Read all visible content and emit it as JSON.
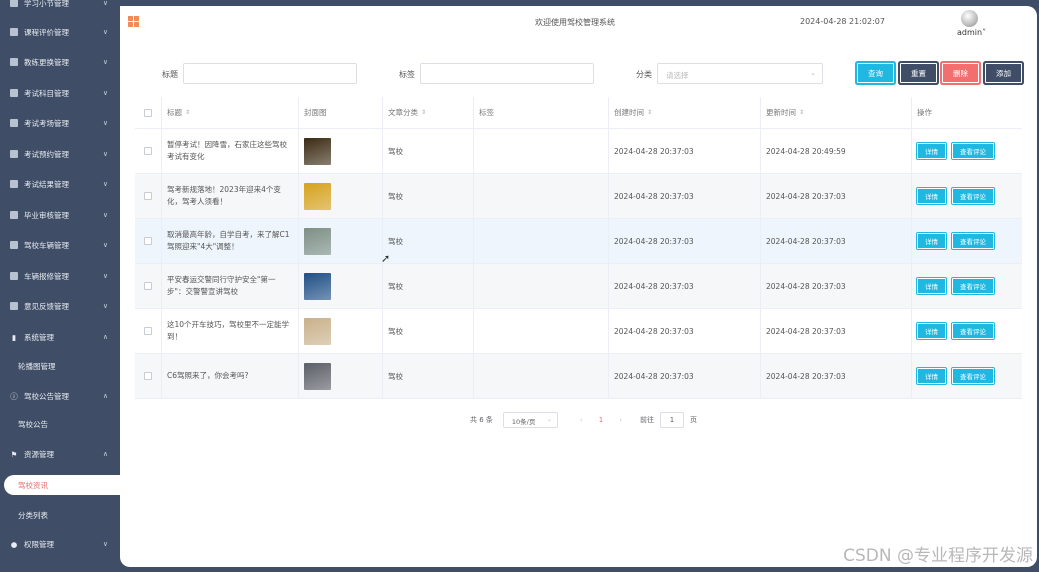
{
  "sidebar": {
    "items": [
      {
        "label": "学习小节管理",
        "icon": "doc-icon",
        "arrow": "∨"
      },
      {
        "label": "课程评价管理",
        "icon": "doc-icon",
        "arrow": "∨"
      },
      {
        "label": "教练更换管理",
        "icon": "doc-icon",
        "arrow": "∨"
      },
      {
        "label": "考试科目管理",
        "icon": "doc-icon",
        "arrow": "∨"
      },
      {
        "label": "考试考场管理",
        "icon": "doc-icon",
        "arrow": "∨"
      },
      {
        "label": "考试预约管理",
        "icon": "doc-icon",
        "arrow": "∨"
      },
      {
        "label": "考试结果管理",
        "icon": "doc-icon",
        "arrow": "∨"
      },
      {
        "label": "毕业审核管理",
        "icon": "doc-icon",
        "arrow": "∨"
      },
      {
        "label": "驾校车辆管理",
        "icon": "doc-icon",
        "arrow": "∨"
      },
      {
        "label": "车辆报修管理",
        "icon": "doc-icon",
        "arrow": "∨"
      },
      {
        "label": "意见反馈管理",
        "icon": "doc-icon",
        "arrow": "∨"
      },
      {
        "label": "系统管理",
        "icon": "bar-chart-icon",
        "arrow": "∧"
      },
      {
        "label": "轮播图管理",
        "icon": "",
        "arrow": ""
      },
      {
        "label": "驾校公告管理",
        "icon": "info-icon",
        "arrow": "∧"
      },
      {
        "label": "驾校公告",
        "icon": "",
        "arrow": ""
      },
      {
        "label": "资源管理",
        "icon": "flag-icon",
        "arrow": "∧"
      },
      {
        "label": "驾校资讯",
        "icon": "",
        "arrow": ""
      },
      {
        "label": "分类列表",
        "icon": "",
        "arrow": ""
      },
      {
        "label": "权限管理",
        "icon": "user-icon",
        "arrow": "∨"
      }
    ]
  },
  "header": {
    "welcome": "欢迎使用驾校管理系统",
    "datetime": "2024-04-28 21:02:07",
    "user": "admin",
    "user_caret": "˅"
  },
  "search": {
    "title_label": "标题",
    "tag_label": "标签",
    "category_label": "分类",
    "category_placeholder": "请选择",
    "query": "查询",
    "reset": "重置",
    "delete": "删除",
    "add": "添加"
  },
  "table": {
    "headers": [
      "标题",
      "封面图",
      "文章分类",
      "标签",
      "创建时间",
      "更新时间",
      "操作"
    ],
    "rows": [
      {
        "title": "暂停考试！因降雪，石家庄这些驾校考试有变化",
        "category": "驾校",
        "tag": "",
        "created": "2024-04-28 20:37:03",
        "updated": "2024-04-28 20:49:59",
        "thumb": "#3a2a12"
      },
      {
        "title": "驾考新规落地！2023年迎来4个变化，驾考人须看！",
        "category": "驾校",
        "tag": "",
        "created": "2024-04-28 20:37:03",
        "updated": "2024-04-28 20:37:03",
        "thumb": "#d7a21b"
      },
      {
        "title": "取消最高年龄，自学自考，来了解C1驾照迎来\"4大\"调整！",
        "category": "驾校",
        "tag": "",
        "created": "2024-04-28 20:37:03",
        "updated": "2024-04-28 20:37:03",
        "thumb": "#7d8f84"
      },
      {
        "title": "平安春运交警同行守护安全\"第一步\"：交警警宣讲驾校",
        "category": "驾校",
        "tag": "",
        "created": "2024-04-28 20:37:03",
        "updated": "2024-04-28 20:37:03",
        "thumb": "#1f4f86"
      },
      {
        "title": "这10个开车技巧，驾校里不一定能学到！",
        "category": "驾校",
        "tag": "",
        "created": "2024-04-28 20:37:03",
        "updated": "2024-04-28 20:37:03",
        "thumb": "#c8b08a"
      },
      {
        "title": "C6驾照来了，你会考吗?",
        "category": "驾校",
        "tag": "",
        "created": "2024-04-28 20:37:03",
        "updated": "2024-04-28 20:37:03",
        "thumb": "#5b5f66"
      }
    ],
    "detail": "详情",
    "comment": "查看评论"
  },
  "pager": {
    "total": "共 6 条",
    "size": "10条/页",
    "prev": "‹",
    "page": "1",
    "next": "›",
    "goto": "前往",
    "goto_value": "1",
    "page_unit": "页"
  },
  "watermark": "CSDN @专业程序开发源",
  "colors": {
    "sidebar": "#3f4d66",
    "accent_blue": "#1fb8e0",
    "delete_red": "#f36f6f",
    "grid_orange": "#f08b5a"
  }
}
